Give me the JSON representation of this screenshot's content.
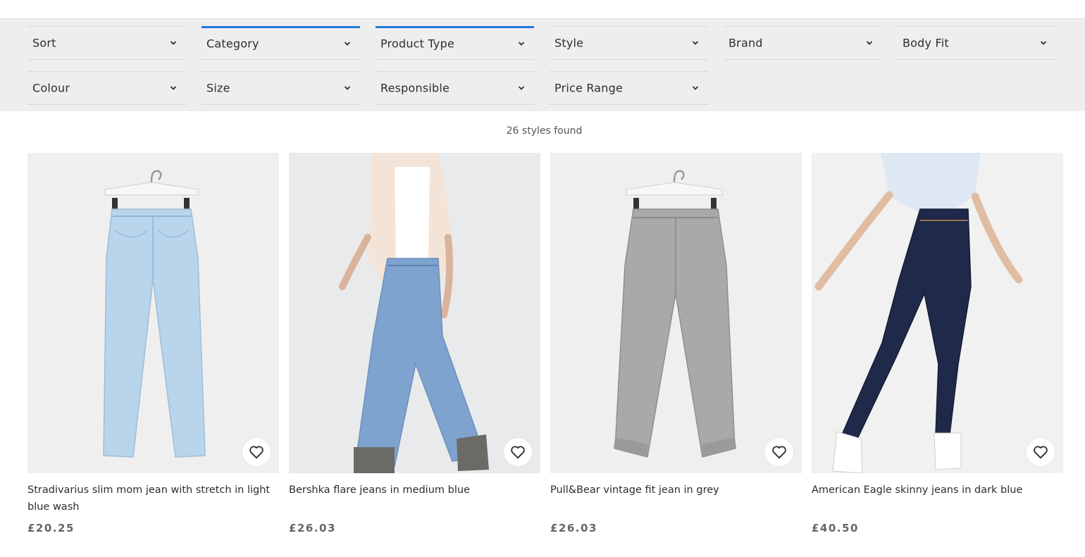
{
  "filters": [
    {
      "label": "Sort",
      "active": false
    },
    {
      "label": "Category",
      "active": true
    },
    {
      "label": "Product Type",
      "active": true
    },
    {
      "label": "Style",
      "active": false
    },
    {
      "label": "Brand",
      "active": false
    },
    {
      "label": "Body Fit",
      "active": false
    },
    {
      "label": "Colour",
      "active": false
    },
    {
      "label": "Size",
      "active": false
    },
    {
      "label": "Responsible",
      "active": false
    },
    {
      "label": "Price Range",
      "active": false
    }
  ],
  "results": {
    "count_text": "26 styles found"
  },
  "products": [
    {
      "name": "Stradivarius slim mom jean with stretch in light blue wash",
      "price": "£20.25"
    },
    {
      "name": "Bershka flare jeans in medium blue",
      "price": "£26.03"
    },
    {
      "name": "Pull&Bear vintage fit jean in grey",
      "price": "£26.03"
    },
    {
      "name": "American Eagle skinny jeans in dark blue",
      "price": "£40.50"
    }
  ],
  "icons": {
    "filter_chevron": "chevron-down-icon",
    "save": "heart-icon"
  },
  "colors": {
    "accent": "#2677d9",
    "filter_bg": "#eeeeee",
    "denim_light": "#b9d5ec",
    "denim_medium": "#7ea3cf",
    "denim_grey": "#a9a9ab",
    "denim_dark": "#1f2a4a"
  }
}
